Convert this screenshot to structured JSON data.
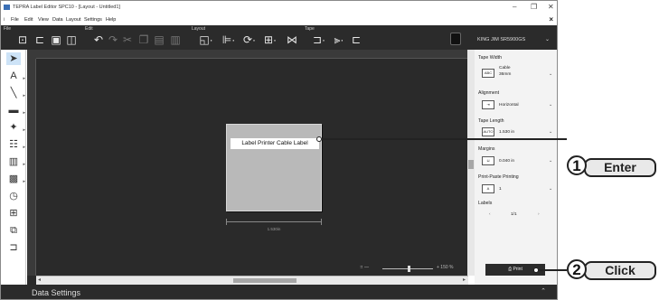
{
  "titlebar": {
    "title": "TEPRA Label Editor SPC10 - [Layout - Untitled1]",
    "minimize": "–",
    "restore": "❐",
    "close": "✕"
  },
  "menubar": {
    "items": [
      "File",
      "Edit",
      "View",
      "Data",
      "Layout",
      "Settings",
      "Help"
    ],
    "close_doc": "×"
  },
  "ribbon": {
    "groups": [
      "File",
      "Edit",
      "Layout",
      "Tape"
    ],
    "printer_name": "KING JIM SR5900GS"
  },
  "canvas": {
    "label_text": "Label Printer  Cable Label",
    "tape_length_marker": "1.530in",
    "zoom_level": "+ 150 %"
  },
  "panel": {
    "tape_width": {
      "title": "Tape Width",
      "value_line1": "Cable",
      "value_line2": "36mm"
    },
    "alignment": {
      "title": "Alignment",
      "value": "Horizontal"
    },
    "tape_length": {
      "title": "Tape Length",
      "icon_text": "AUTO",
      "value": "1.530 in"
    },
    "margins": {
      "title": "Margins",
      "value": "0.040 in"
    },
    "print_paste": {
      "title": "Print-Paste Printing",
      "value": "1"
    },
    "labels": {
      "title": "Labels",
      "value": "1/1"
    },
    "print_button": "Print"
  },
  "footer": {
    "label": "Data Settings"
  },
  "callouts": {
    "one": {
      "number": "1",
      "text": "Enter"
    },
    "two": {
      "number": "2",
      "text": "Click"
    }
  }
}
